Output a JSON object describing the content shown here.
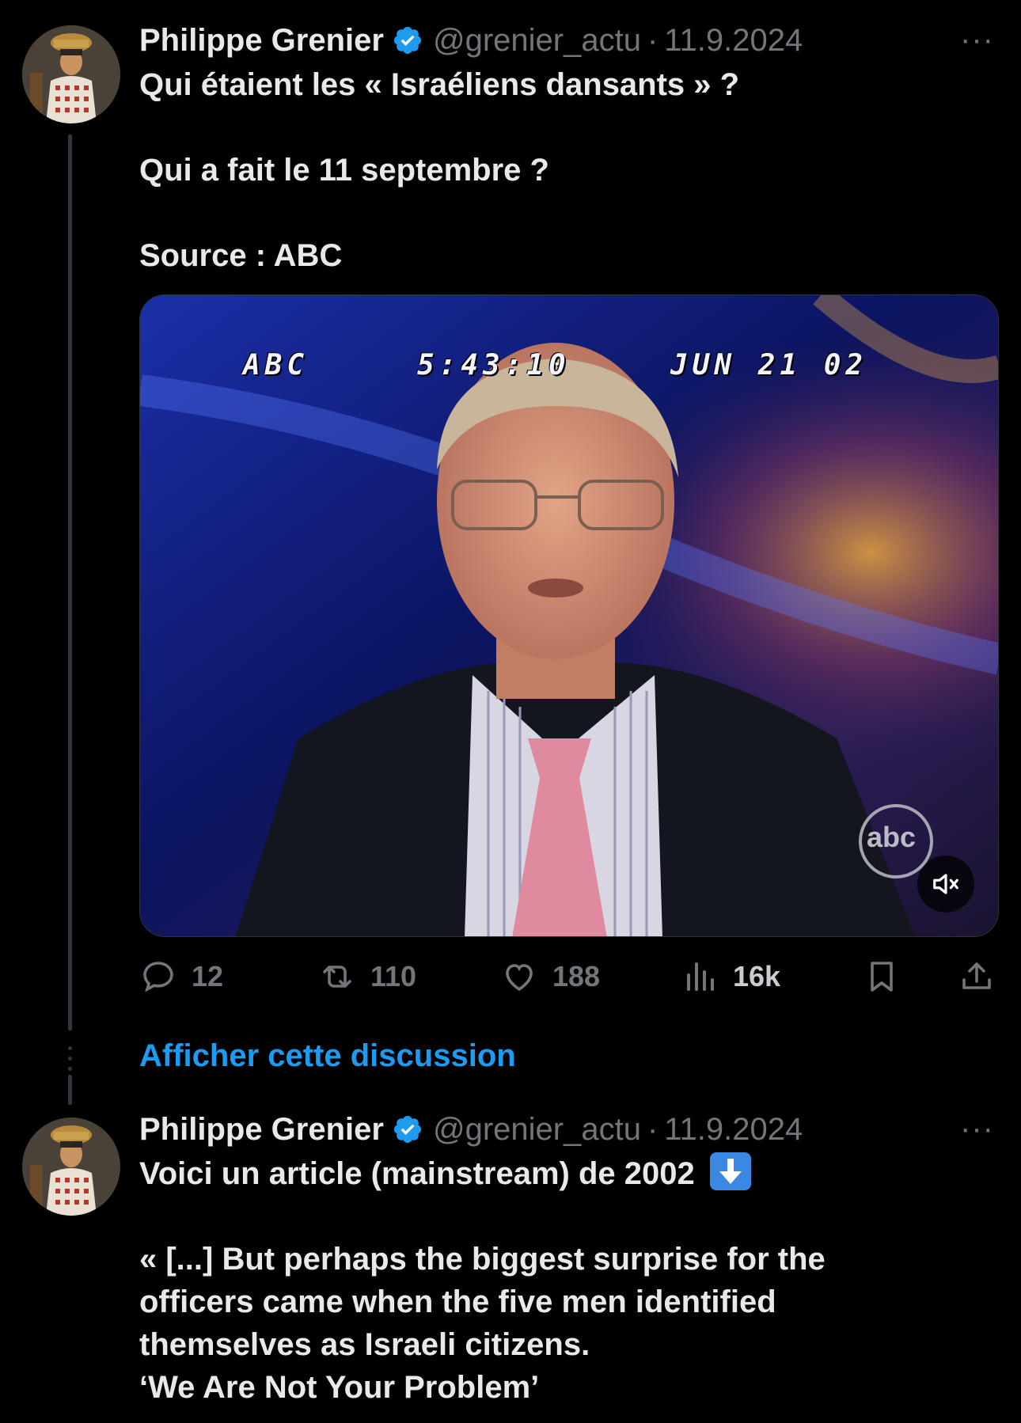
{
  "tweet1": {
    "author_name": "Philippe Grenier",
    "handle": "@grenier_actu",
    "separator": "·",
    "date": "11.9.2024",
    "more": "···",
    "lines": [
      "Qui étaient les « Israéliens dansants » ?",
      "Qui a fait le 11 septembre ?",
      "Source : ABC"
    ],
    "video": {
      "osd_channel": "ABC",
      "osd_time": "5:43:10",
      "osd_date": "JUN 21 02",
      "logo": "abc"
    },
    "actions": {
      "replies": "12",
      "reposts": "110",
      "likes": "188",
      "views": "16k"
    }
  },
  "show_thread": "Afficher cette discussion",
  "tweet2": {
    "author_name": "Philippe Grenier",
    "handle": "@grenier_actu",
    "separator": "·",
    "date": "11.9.2024",
    "more": "···",
    "line1": "Voici un article  (mainstream) de 2002",
    "emoji": "down-arrow-emoji",
    "quote_lines": [
      "« [...] But perhaps the biggest surprise for the",
      "officers came when the five men identified",
      "themselves as Israeli citizens.",
      "‘We Are Not Your Problem’"
    ]
  },
  "colors": {
    "accent": "#1d9bf0",
    "muted": "#71767b",
    "text": "#e7e9ea",
    "bg": "#000000"
  }
}
